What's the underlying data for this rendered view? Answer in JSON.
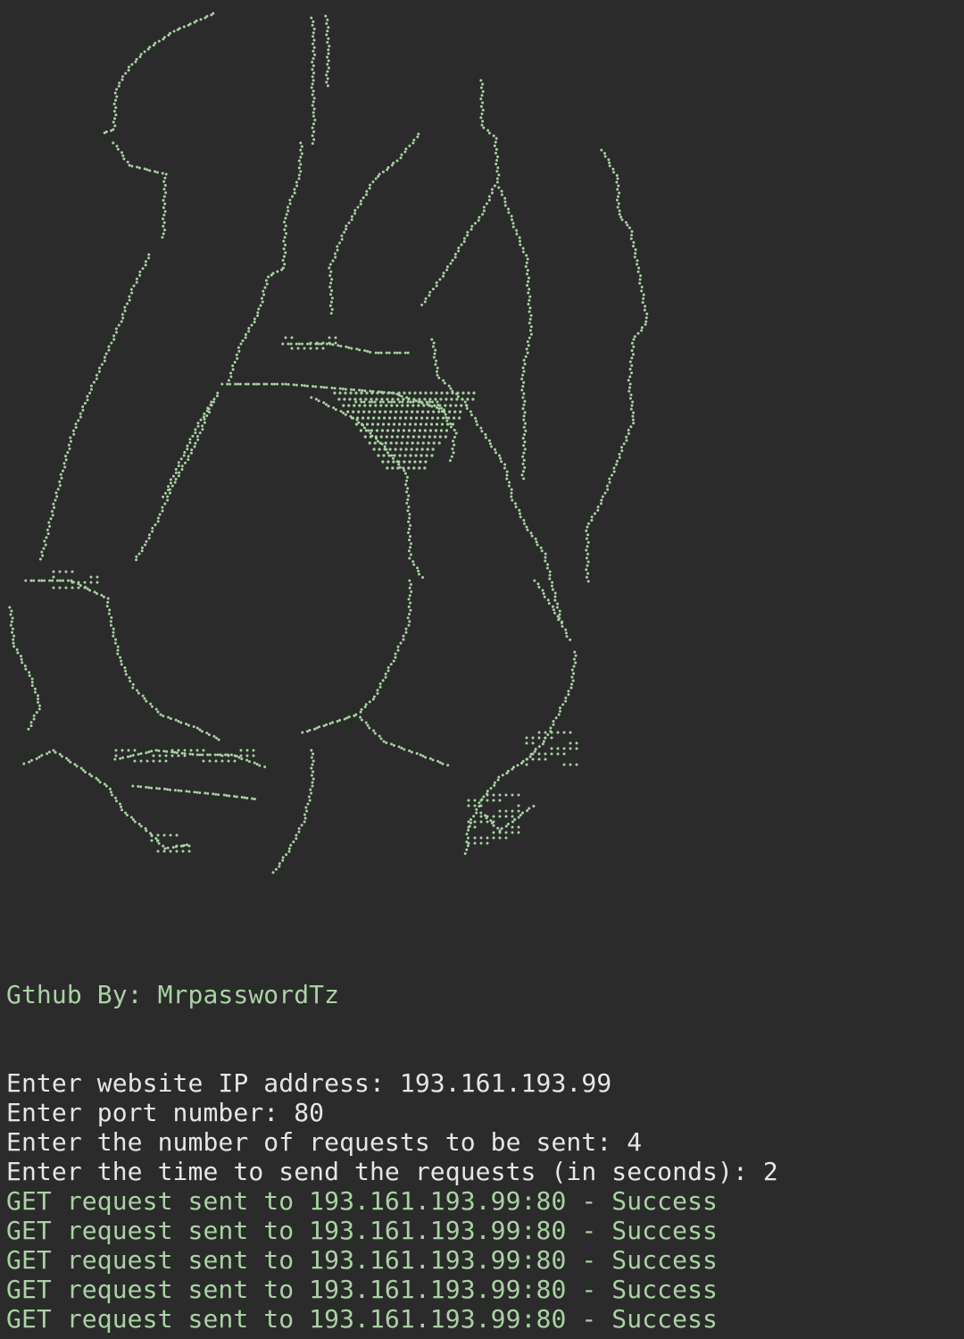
{
  "terminal": {
    "background_color": "#2b2b2b",
    "art_color": "#a9d3a3",
    "credit": "Gthub By: MrpasswordTz",
    "prompts": [
      "Enter website IP address: 193.161.193.99",
      "Enter port number: 80",
      "Enter the number of requests to be sent: 4",
      "Enter the time to send the requests (in seconds): 2"
    ],
    "results": [
      "GET request sent to 193.161.193.99:80 - Success",
      "GET request sent to 193.161.193.99:80 - Success",
      "GET request sent to 193.161.193.99:80 - Success",
      "GET request sent to 193.161.193.99:80 - Success",
      "GET request sent to 193.161.193.99:80 - Success"
    ]
  }
}
